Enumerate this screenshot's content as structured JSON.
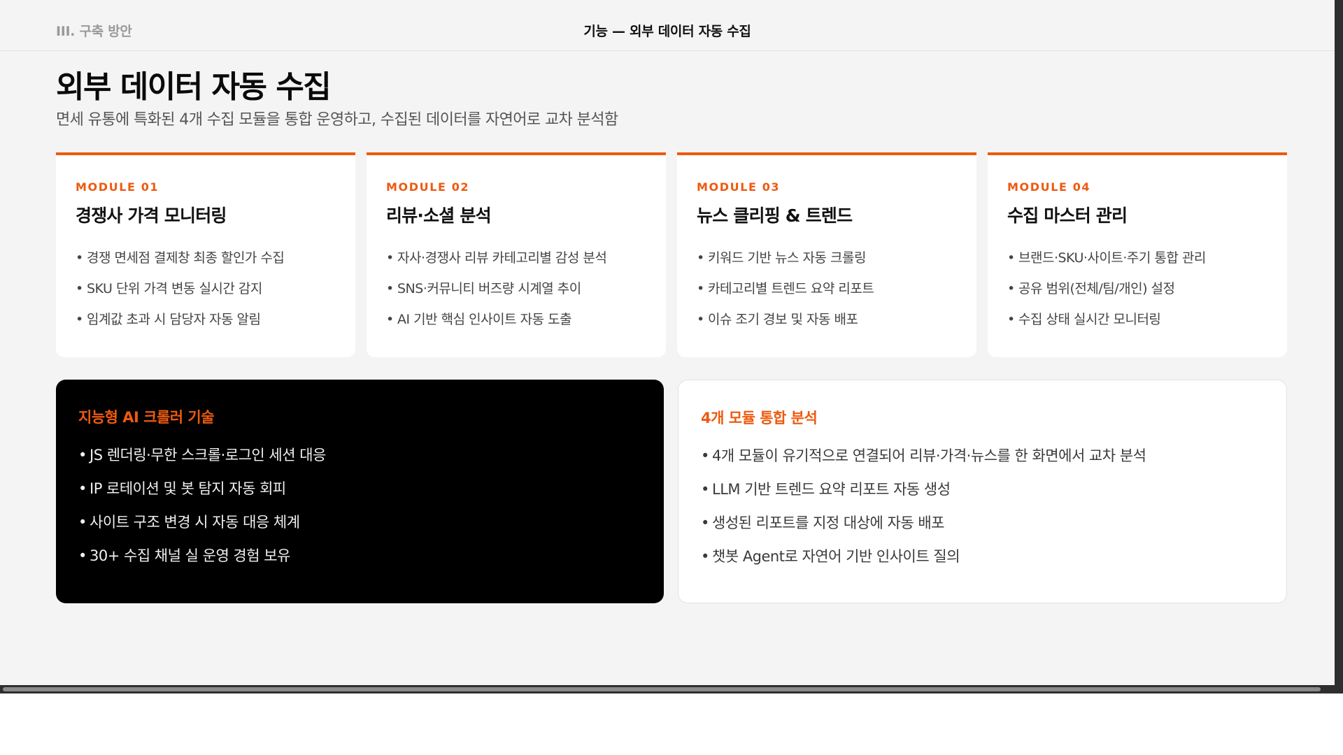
{
  "header": {
    "section_label": "III. 구축 방안",
    "title": "기능 — 외부 데이터 자동 수집"
  },
  "page": {
    "title": "외부 데이터 자동 수집",
    "subtitle": "면세 유통에 특화된 4개 수집 모듈을 통합 운영하고, 수집된 데이터를 자연어로 교차 분석함"
  },
  "bullet_glyph": "•",
  "modules": [
    {
      "tag": "MODULE 01",
      "title": "경쟁사 가격 모니터링",
      "items": [
        "경쟁 면세점 결제창 최종 할인가 수집",
        "SKU 단위 가격 변동 실시간 감지",
        "임계값 초과 시 담당자 자동 알림"
      ]
    },
    {
      "tag": "MODULE 02",
      "title": "리뷰·소셜 분석",
      "items": [
        "자사·경쟁사 리뷰 카테고리별 감성 분석",
        "SNS·커뮤니티 버즈량 시계열 추이",
        "AI 기반 핵심 인사이트 자동 도출"
      ]
    },
    {
      "tag": "MODULE 03",
      "title": "뉴스 클리핑 & 트렌드",
      "items": [
        "키워드 기반 뉴스 자동 크롤링",
        "카테고리별 트렌드 요약 리포트",
        "이슈 조기 경보 및 자동 배포"
      ]
    },
    {
      "tag": "MODULE 04",
      "title": "수집 마스터 관리",
      "items": [
        "브랜드·SKU·사이트·주기 통합 관리",
        "공유 범위(전체/팀/개인) 설정",
        "수집 상태 실시간 모니터링"
      ]
    }
  ],
  "panels": {
    "crawler": {
      "title": "지능형 AI 크롤러 기술",
      "items": [
        "JS 렌더링·무한 스크롤·로그인 세션 대응",
        "IP 로테이션 및 봇 탐지 자동 회피",
        "사이트 구조 변경 시 자동 대응 체계",
        "30+ 수집 채널 실 운영 경험 보유"
      ]
    },
    "integration": {
      "title": "4개 모듈 통합 분석",
      "items": [
        "4개 모듈이 유기적으로 연결되어 리뷰·가격·뉴스를 한 화면에서 교차 분석",
        "LLM 기반 트렌드 요약 리포트 자동 생성",
        "생성된 리포트를 지정 대상에 자동 배포",
        "챗봇 Agent로 자연어 기반 인사이트 질의"
      ]
    }
  },
  "colors": {
    "accent": "#ee5a0f",
    "dark_panel": "#000000",
    "background": "#f4f4f4"
  }
}
